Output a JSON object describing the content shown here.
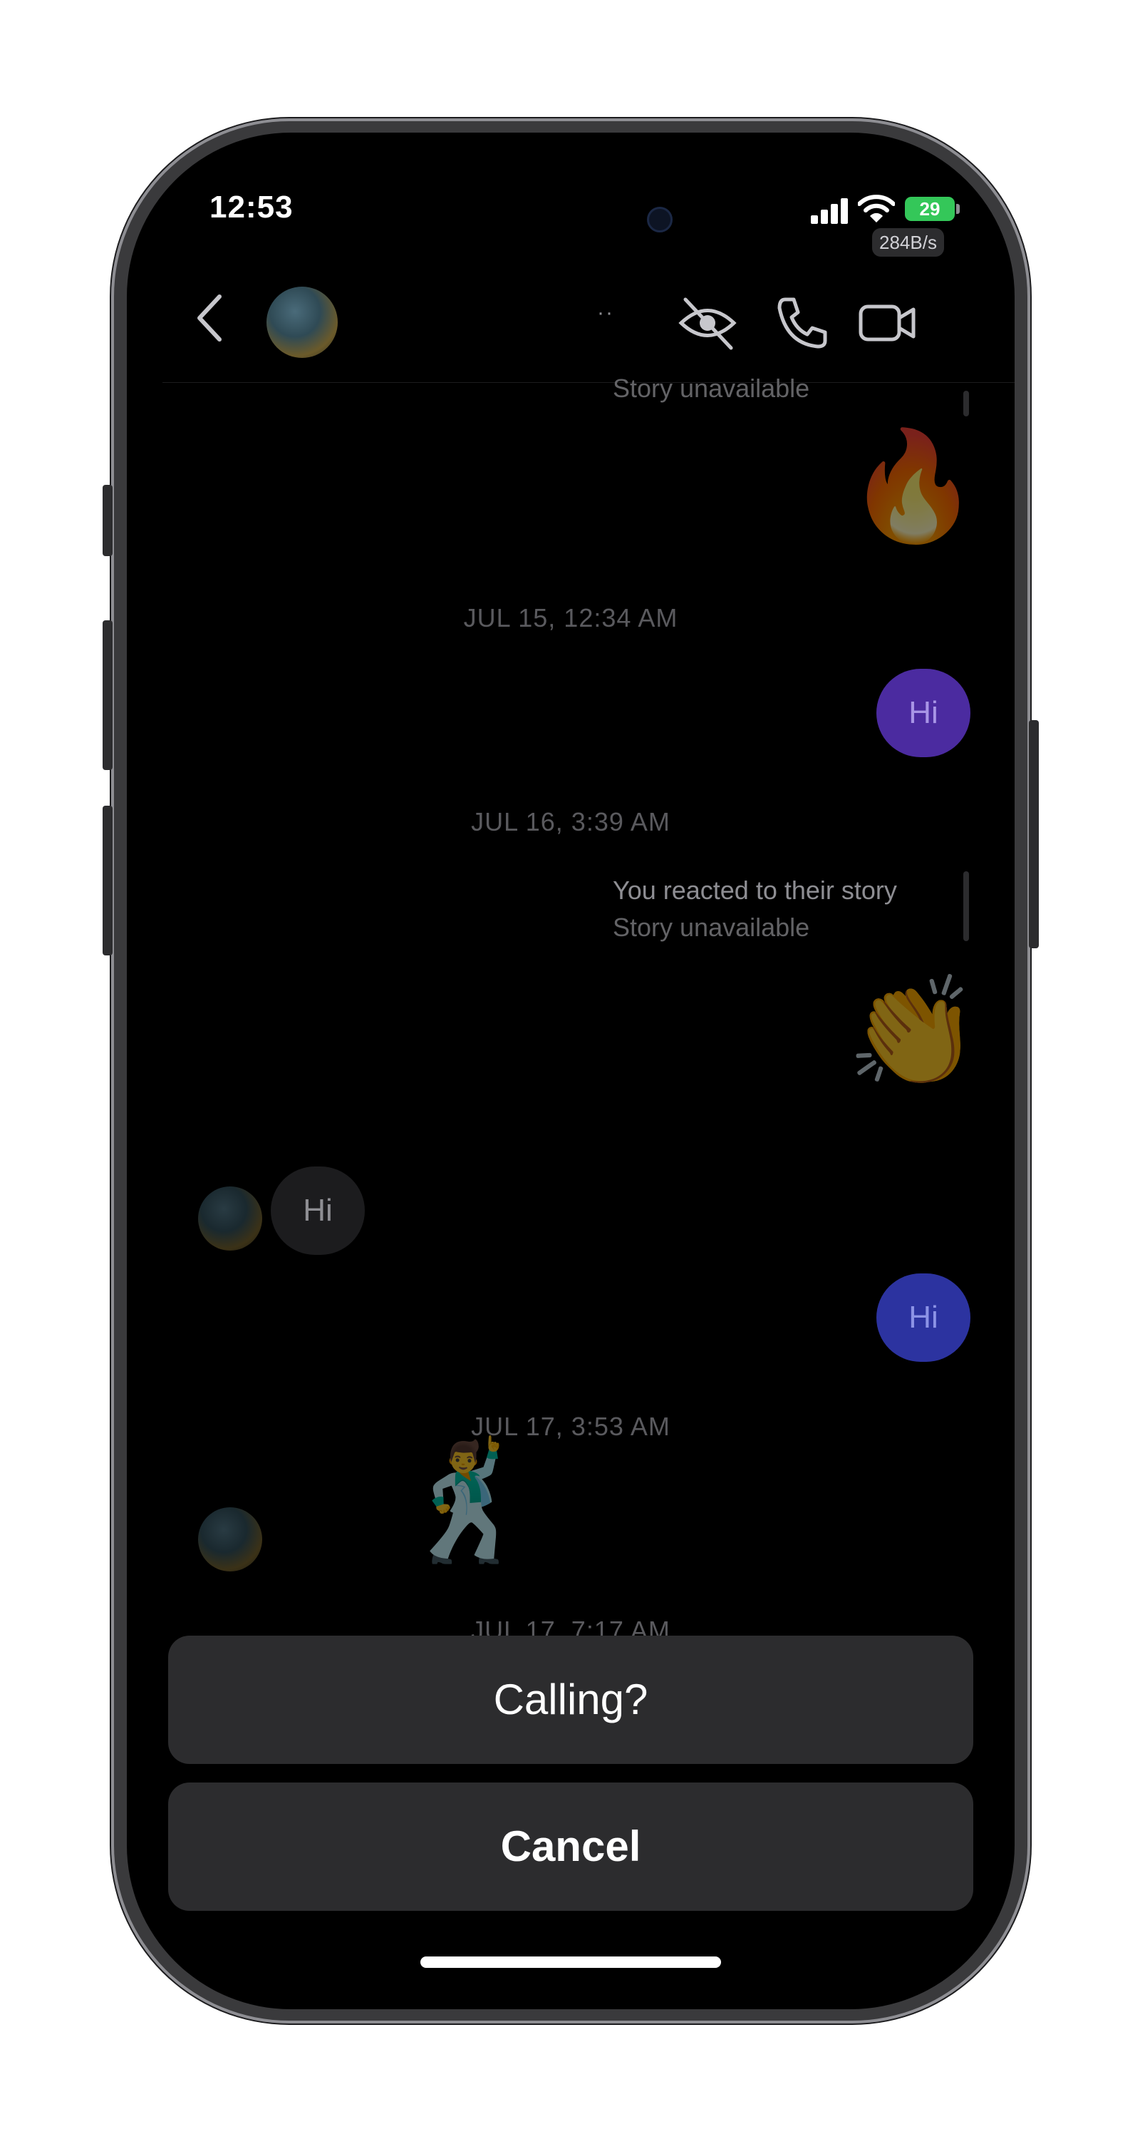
{
  "status_bar": {
    "time": "12:53",
    "battery": "29",
    "net_speed": "284B/s"
  },
  "header": {
    "dots": "··",
    "icons": [
      "back-chevron-icon",
      "avatar",
      "eye-slash-icon",
      "phone-icon",
      "video-camera-icon"
    ]
  },
  "messages": {
    "story_top_partial": "Story unavailable",
    "emoji_fire": "🔥",
    "ts1": "JUL 15, 12:34 AM",
    "hi_out_1": "Hi",
    "ts2": "JUL 16, 3:39 AM",
    "story_reacted": "You reacted to their story",
    "story_unavailable": "Story unavailable",
    "emoji_clap": "👏",
    "hi_in": "Hi",
    "hi_out_2": "Hi",
    "ts3": "JUL 17, 3:53 AM",
    "emoji_kiss": "😘",
    "emoji_dance": "🕺",
    "ts4_partial": "JUL 17, 7:17 AM"
  },
  "action_sheet": {
    "title": "Calling?",
    "cancel": "Cancel"
  },
  "colors": {
    "background": "#000000",
    "outgoing_bubble": "#4b2ba0",
    "outgoing_bubble_2": "#2c33a0",
    "incoming_bubble": "#1c1c1e",
    "sheet": "#2c2c2e",
    "battery": "#34c759"
  }
}
